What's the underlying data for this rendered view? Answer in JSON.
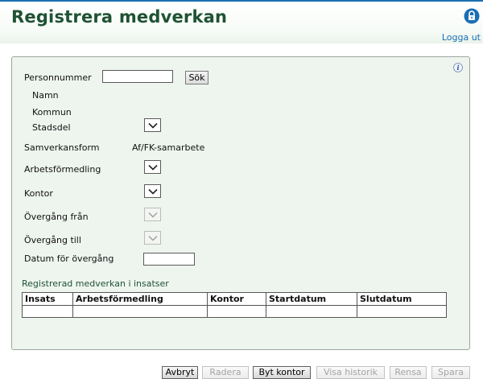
{
  "header": {
    "title": "Registrera medverkan",
    "logout_label": "Logga ut"
  },
  "form": {
    "personnummer": {
      "label": "Personnummer",
      "value": "",
      "search_label": "Sök"
    },
    "namn_label": "Namn",
    "kommun_label": "Kommun",
    "stadsdel_label": "Stadsdel",
    "samverkansform": {
      "label": "Samverkansform",
      "value": "Af/FK-samarbete"
    },
    "arbetsformedling_label": "Arbetsförmedling",
    "kontor_label": "Kontor",
    "overgang_fran_label": "Övergång från",
    "overgang_till_label": "Övergång till",
    "datum_overgang": {
      "label": "Datum för övergång",
      "value": ""
    }
  },
  "table": {
    "title": "Registrerad medverkan i insatser",
    "columns": [
      "Insats",
      "Arbetsförmedling",
      "Kontor",
      "Startdatum",
      "Slutdatum"
    ]
  },
  "buttons": {
    "avbryt": "Avbryt",
    "radera": "Radera",
    "byt_kontor": "Byt kontor",
    "visa_historik": "Visa historik",
    "rensa": "Rensa",
    "spara": "Spara"
  },
  "icons": {
    "lock": "lock-icon",
    "info": "info-icon",
    "dropdown": "chevron-down-icon"
  },
  "colors": {
    "accent": "#1a6fb4",
    "title": "#1f5233",
    "panel_bg": "#eef5ef"
  }
}
